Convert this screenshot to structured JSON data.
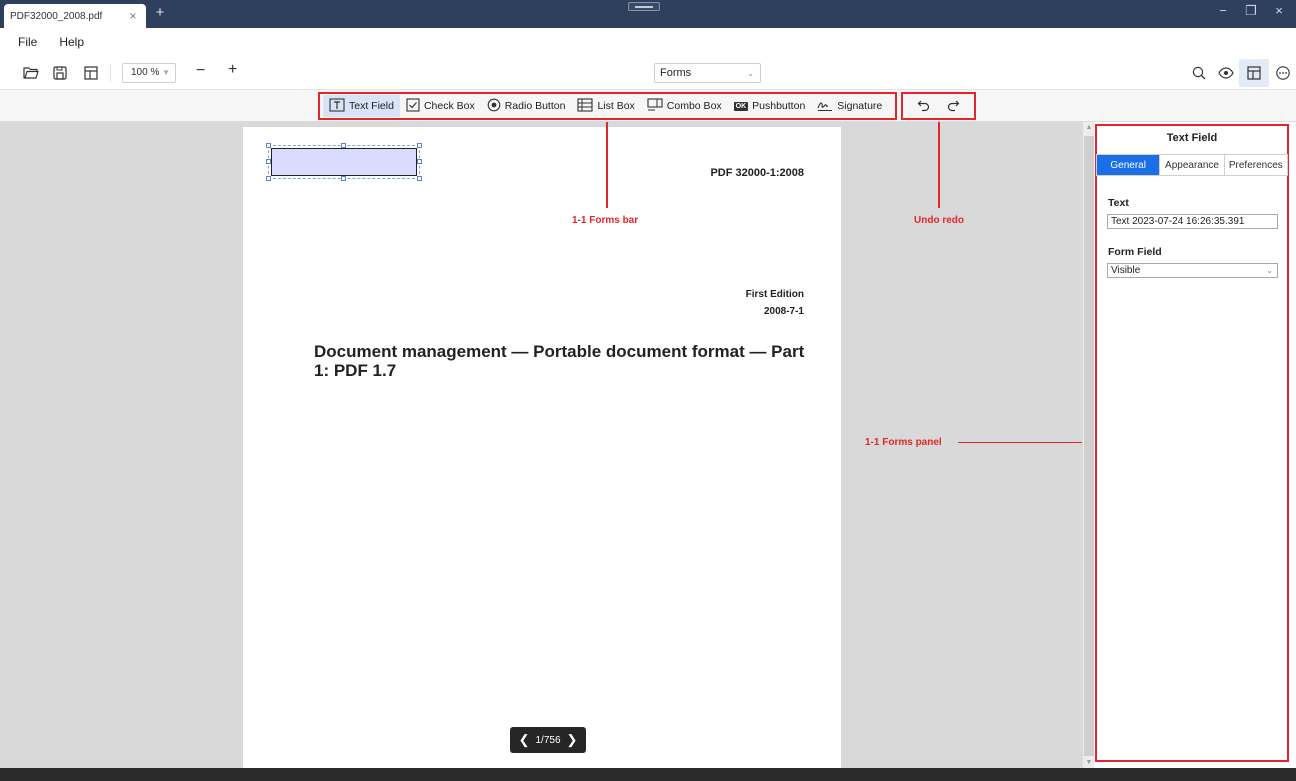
{
  "window": {
    "tab_title": "PDF32000_2008.pdf",
    "tab_close": "×",
    "new_tab": "+",
    "controls": [
      "−",
      "❐",
      "×"
    ]
  },
  "menu": {
    "file": "File",
    "help": "Help"
  },
  "toolbar": {
    "zoom_value": "100 %",
    "zoom_minus": "−",
    "zoom_plus": "+",
    "mode": "Forms"
  },
  "forms_bar": {
    "items": [
      {
        "label": "Text Field",
        "icon": "text-field-icon",
        "active": true
      },
      {
        "label": "Check Box",
        "icon": "checkbox-icon"
      },
      {
        "label": "Radio Button",
        "icon": "radio-icon"
      },
      {
        "label": "List Box",
        "icon": "list-box-icon"
      },
      {
        "label": "Combo Box",
        "icon": "combo-box-icon"
      },
      {
        "label": "Pushbutton",
        "icon": "pushbutton-icon",
        "badge": "OK"
      },
      {
        "label": "Signature",
        "icon": "signature-icon"
      }
    ]
  },
  "document": {
    "code": "PDF 32000-1:2008",
    "edition": "First Edition",
    "date": "2008-7-1",
    "title": "Document management — Portable document format — Part 1: PDF 1.7",
    "page_indicator": "1/756"
  },
  "annotations": {
    "forms_bar": "1-1 Forms bar",
    "undo_redo": "Undo redo",
    "forms_panel": "1-1 Forms panel"
  },
  "panel": {
    "title": "Text Field",
    "tabs": [
      "General",
      "Appearance",
      "Preferences"
    ],
    "text_label": "Text",
    "text_value": "Text 2023-07-24 16:26:35.391",
    "form_field_label": "Form Field",
    "form_field_value": "Visible"
  },
  "colors": {
    "titlebar": "#2f3f5e",
    "accent": "#1a6fe8",
    "annotation": "#e3262c"
  }
}
